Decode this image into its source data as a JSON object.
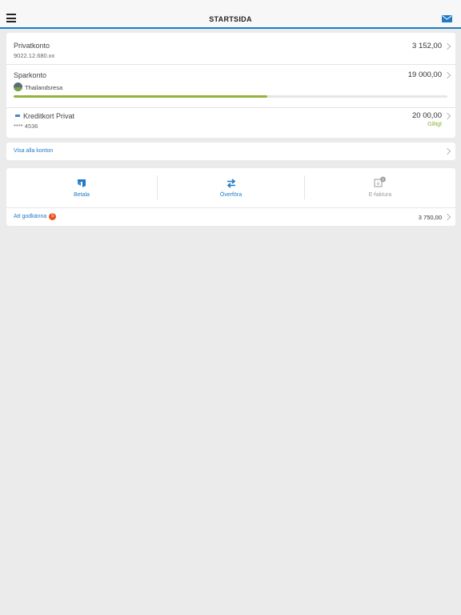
{
  "header": {
    "title": "STARTSIDA"
  },
  "accounts": [
    {
      "name": "Privatkonto",
      "number": "9022.12.680.xx",
      "amount": "3 152,00"
    },
    {
      "name": "Sparkonto",
      "goal": "Thailandsresa",
      "amount": "19 000,00",
      "progress": 0.585
    },
    {
      "name": "Kreditkort Privat",
      "number": "**** 4536",
      "amount": "20 00,00",
      "status": "Giltigt"
    }
  ],
  "show_all_label": "Visa alla konton",
  "actions": [
    {
      "label": "Betala",
      "icon": "pay-icon",
      "color": "#2179c8"
    },
    {
      "label": "Överföra",
      "icon": "transfer-icon",
      "color": "#2179c8"
    },
    {
      "label": "E-faktura",
      "icon": "e-invoice-icon",
      "color": "#9a9a9a",
      "badge": "0"
    }
  ],
  "approve": {
    "label": "Att godkänna",
    "count": "5",
    "amount": "3 750,00"
  },
  "colors": {
    "accent": "#2179c8",
    "progress": "#94b23d",
    "badge": "#e8531d"
  }
}
